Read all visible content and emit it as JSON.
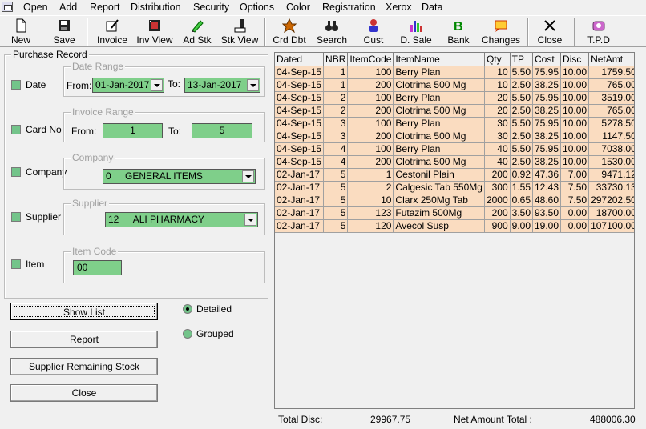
{
  "menu": [
    "Open",
    "Add",
    "Report",
    "Distribution",
    "Security",
    "Options",
    "Color",
    "Registration",
    "Xerox",
    "Data"
  ],
  "toolbar": [
    {
      "label": "New",
      "icon": "new-page-icon"
    },
    {
      "label": "Save",
      "icon": "floppy-disk-icon"
    },
    {
      "label": "Invoice",
      "icon": "invoice-pen-icon"
    },
    {
      "label": "Inv View",
      "icon": "film-icon"
    },
    {
      "label": "Ad Stk",
      "icon": "pencil-icon"
    },
    {
      "label": "Stk View",
      "icon": "stock-view-icon"
    },
    {
      "label": "Crd Dbt",
      "icon": "credit-debit-icon"
    },
    {
      "label": "Search",
      "icon": "binoculars-icon"
    },
    {
      "label": "Cust",
      "icon": "customer-icon"
    },
    {
      "label": "D. Sale",
      "icon": "bar-chart-icon"
    },
    {
      "label": "Bank",
      "icon": "bank-icon"
    },
    {
      "label": "Changes",
      "icon": "changes-icon"
    },
    {
      "label": "Close",
      "icon": "close-x-icon"
    },
    {
      "label": "T.P.D",
      "icon": "tpd-icon"
    }
  ],
  "purchase_record": {
    "title": "Purchase Record",
    "date": {
      "label": "Date",
      "group": "Date Range",
      "from_label": "From:",
      "from": "01-Jan-2017",
      "to_label": "To:",
      "to": "13-Jan-2017"
    },
    "card": {
      "label": "Card No",
      "group": "Invoice Range",
      "from_label": "From:",
      "from": "1",
      "to_label": "To:",
      "to": "5"
    },
    "company": {
      "label": "Company",
      "group": "Company",
      "value_code": "0",
      "value_name": "GENERAL ITEMS"
    },
    "supplier": {
      "label": "Supplier",
      "group": "Supplier",
      "value_code": "12",
      "value_name": "ALI PHARMACY"
    },
    "item": {
      "label": "Item",
      "group": "Item Code",
      "value": "00"
    }
  },
  "buttons": {
    "show_list": "Show List",
    "report": "Report",
    "supplier_stock": "Supplier Remaining Stock",
    "close": "Close"
  },
  "radios": {
    "detailed": "Detailed",
    "grouped": "Grouped"
  },
  "grid": {
    "columns": [
      "Dated",
      "NBR",
      "ItemCode",
      "ItemName",
      "Qty",
      "TP",
      "Cost",
      "Disc",
      "NetAmt"
    ],
    "rows": [
      [
        "04-Sep-15",
        "1",
        "100",
        "Berry Plan",
        "10",
        "5.50",
        "75.95",
        "10.00",
        "1759.50"
      ],
      [
        "04-Sep-15",
        "1",
        "200",
        "Clotrima 500 Mg",
        "10",
        "2.50",
        "38.25",
        "10.00",
        "765.00"
      ],
      [
        "04-Sep-15",
        "2",
        "100",
        "Berry Plan",
        "20",
        "5.50",
        "75.95",
        "10.00",
        "3519.00"
      ],
      [
        "04-Sep-15",
        "2",
        "200",
        "Clotrima 500 Mg",
        "20",
        "2.50",
        "38.25",
        "10.00",
        "765.00"
      ],
      [
        "04-Sep-15",
        "3",
        "100",
        "Berry Plan",
        "30",
        "5.50",
        "75.95",
        "10.00",
        "5278.50"
      ],
      [
        "04-Sep-15",
        "3",
        "200",
        "Clotrima 500 Mg",
        "30",
        "2.50",
        "38.25",
        "10.00",
        "1147.50"
      ],
      [
        "04-Sep-15",
        "4",
        "100",
        "Berry Plan",
        "40",
        "5.50",
        "75.95",
        "10.00",
        "7038.00"
      ],
      [
        "04-Sep-15",
        "4",
        "200",
        "Clotrima 500 Mg",
        "40",
        "2.50",
        "38.25",
        "10.00",
        "1530.00"
      ],
      [
        "02-Jan-17",
        "5",
        "1",
        "Cestonil Plain",
        "200",
        "0.92",
        "47.36",
        "7.00",
        "9471.12"
      ],
      [
        "02-Jan-17",
        "5",
        "2",
        "Calgesic Tab 550Mg",
        "300",
        "1.55",
        "12.43",
        "7.50",
        "33730.13"
      ],
      [
        "02-Jan-17",
        "5",
        "10",
        "Clarx 250Mg Tab",
        "2000",
        "0.65",
        "48.60",
        "7.50",
        "297202.50"
      ],
      [
        "02-Jan-17",
        "5",
        "123",
        "Futazim 500Mg",
        "200",
        "3.50",
        "93.50",
        "0.00",
        "18700.00"
      ],
      [
        "02-Jan-17",
        "5",
        "120",
        "Avecol Susp",
        "900",
        "9.00",
        "19.00",
        "0.00",
        "107100.00"
      ]
    ]
  },
  "footer": {
    "total_disc_label": "Total Disc:",
    "total_disc": "29967.75",
    "net_amount_label": "Net Amount Total :",
    "net_amount": "488006.30"
  },
  "colors": {
    "field_green": "#7fcf8a",
    "row_peach": "#fadcc0"
  }
}
